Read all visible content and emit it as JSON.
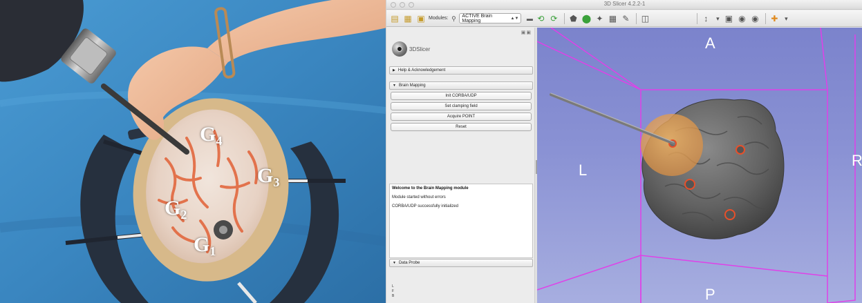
{
  "photo": {
    "labels": [
      {
        "letter": "G",
        "sub": "4"
      },
      {
        "letter": "G",
        "sub": "3"
      },
      {
        "letter": "G",
        "sub": "2"
      },
      {
        "letter": "G",
        "sub": "1"
      }
    ]
  },
  "window": {
    "title": "3D Slicer 4.2.2-1"
  },
  "toolbar": {
    "modules_label": "Modules:",
    "module_selected": "ACTIVE Brain Mapping",
    "icons": [
      "load-data-icon",
      "load-dcm-icon",
      "save-icon",
      "search-icon",
      "layout-icon",
      "back-icon",
      "forward-icon",
      "shield-icon",
      "model-icon",
      "crosshair-icon",
      "chart-icon",
      "pen-icon",
      "zoom-icon",
      "mouse-mode-icon",
      "screenshot-icon",
      "camera-icon",
      "scene-view-icon",
      "place-fiducial-icon"
    ],
    "colors": {
      "accent_green": "#3aa13a",
      "accent_orange": "#e08a1e"
    }
  },
  "panel": {
    "logo_text": "3DSlicer",
    "help_section": "Help & Acknowledgement",
    "brain_mapping_section": "Brain Mapping",
    "buttons": [
      "Init CORBA/UDP",
      "Set clamping field",
      "Acquire POINT",
      "Reset"
    ],
    "log": {
      "title": "Welcome to the Brain Mapping module",
      "lines": [
        "Module started without errors",
        "CORBA/UDP successfully initialized"
      ]
    },
    "data_probe_section": "Data Probe",
    "probe_letters": [
      "L",
      "F",
      "B"
    ]
  },
  "view3d": {
    "orientation": {
      "top": "A",
      "left": "L",
      "right": "R",
      "bottom": "P"
    },
    "colors": {
      "box": "#e040e8",
      "brain": "#5f5f5f",
      "target": "#e0a050",
      "marker": "#e8502a"
    }
  }
}
